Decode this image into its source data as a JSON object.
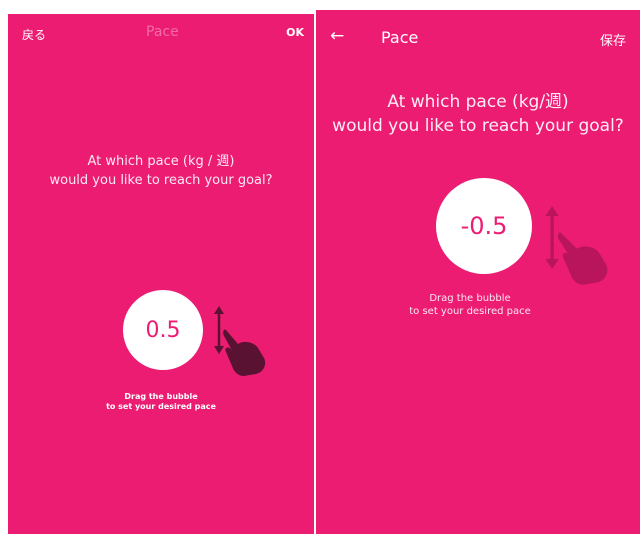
{
  "left": {
    "back_label": "戻る",
    "title": "Pace",
    "ok_label": "OK",
    "question_line1": "At which pace (kg / 週)",
    "question_line2": "would you like to reach your goal?",
    "bubble_value": "0.5",
    "hint_line1": "Drag the bubble",
    "hint_line2": "to set your desired pace"
  },
  "right": {
    "back_icon": "←",
    "title": "Pace",
    "save_label": "保存",
    "question_line1": "At which pace (kg/週)",
    "question_line2": "would you like to reach your goal?",
    "bubble_value": "-0.5",
    "hint_line1": "Drag the bubble",
    "hint_line2": "to set your desired pace"
  },
  "colors": {
    "background": "#ec1c73",
    "bubble": "#ffffff",
    "bubble_text": "#ec1c73",
    "hand_dark": "#5a1232",
    "hand_faded": "#b0145a"
  },
  "icons": [
    "arrow-left-icon",
    "drag-hand-icon",
    "updown-arrow-icon"
  ]
}
